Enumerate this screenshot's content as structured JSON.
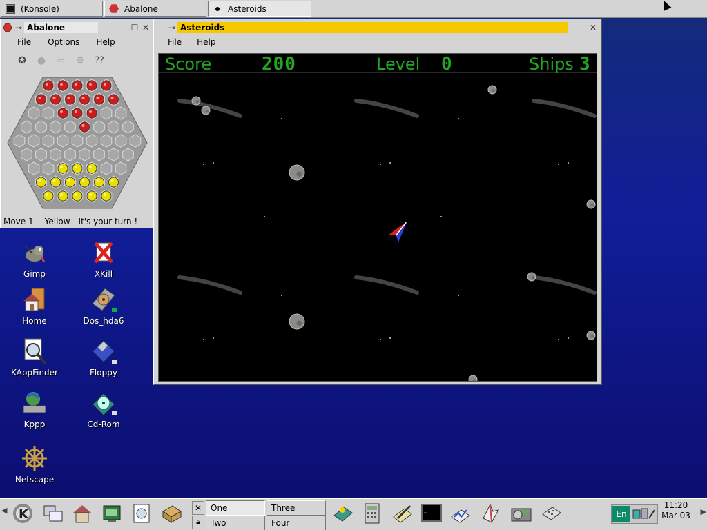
{
  "taskbar": {
    "tasks": [
      {
        "label": "(Konsole)",
        "icon": "terminal-icon"
      },
      {
        "label": "Abalone",
        "icon": "abalone-icon"
      },
      {
        "label": "Asteroids",
        "icon": "dot-icon"
      }
    ]
  },
  "abalone": {
    "title": "Abalone",
    "menu": [
      "File",
      "Options",
      "Help"
    ],
    "status_move": "Move 1",
    "status_turn": "Yellow - It's your turn !"
  },
  "asteroids": {
    "title": "Asteroids",
    "menu": [
      "File",
      "Help"
    ],
    "hud": {
      "score_label": "Score",
      "score_value": "200",
      "level_label": "Level",
      "level_value": "0",
      "ships_label": "Ships",
      "ships_value": "3"
    }
  },
  "desktop_icons": [
    {
      "label": "Gimp",
      "icon": "gimp-icon"
    },
    {
      "label": "XKill",
      "icon": "xkill-icon"
    },
    {
      "label": "Home",
      "icon": "home-icon"
    },
    {
      "label": "Dos_hda6",
      "icon": "harddisk-icon"
    },
    {
      "label": "KAppFinder",
      "icon": "appfinder-icon"
    },
    {
      "label": "Floppy",
      "icon": "floppy-icon"
    },
    {
      "label": "Kppp",
      "icon": "kppp-icon"
    },
    {
      "label": "Cd-Rom",
      "icon": "cdrom-icon"
    },
    {
      "label": "Netscape",
      "icon": "netscape-icon"
    }
  ],
  "panel": {
    "desktops": [
      "One",
      "Two",
      "Three",
      "Four"
    ],
    "active_desktop": "One",
    "language": "En",
    "clock_time": "11:20",
    "clock_date": "Mar 03"
  },
  "colors": {
    "desktop_bg": "#101e98",
    "asteroids_title_bg": "#f5c800",
    "hud_green": "#23a523",
    "abalone_red": "#d11b1b",
    "abalone_yellow": "#e8e000"
  }
}
